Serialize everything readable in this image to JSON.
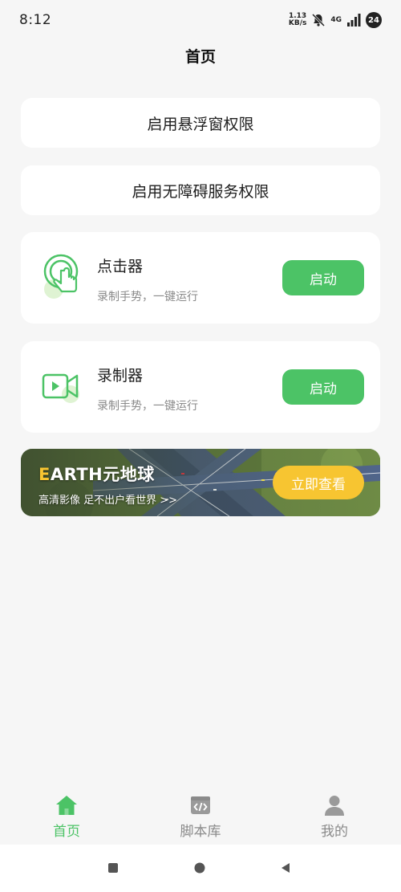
{
  "status_bar": {
    "time": "8:12",
    "net_speed_value": "1.13",
    "net_speed_unit": "KB/s",
    "net_type": "4G",
    "battery": "24"
  },
  "header": {
    "title": "首页"
  },
  "permissions": {
    "float_window": "启用悬浮窗权限",
    "accessibility": "启用无障碍服务权限"
  },
  "tools": [
    {
      "name": "点击器",
      "desc": "录制手势，一键运行",
      "button": "启动",
      "icon": "tap-gesture-icon"
    },
    {
      "name": "录制器",
      "desc": "录制手势，一键运行",
      "button": "启动",
      "icon": "video-camera-icon"
    }
  ],
  "banner": {
    "title_first": "E",
    "title_rest": "ARTH元地球",
    "subtitle": "高清影像 足不出户看世界 >>",
    "button": "立即查看"
  },
  "bottom_nav": [
    {
      "label": "首页",
      "icon": "home-icon",
      "active": true
    },
    {
      "label": "脚本库",
      "icon": "code-icon",
      "active": false
    },
    {
      "label": "我的",
      "icon": "user-icon",
      "active": false
    }
  ],
  "colors": {
    "accent": "#4cc366",
    "banner_button": "#f7c531",
    "background": "#f6f6f6",
    "inactive": "#8a8a8a"
  }
}
